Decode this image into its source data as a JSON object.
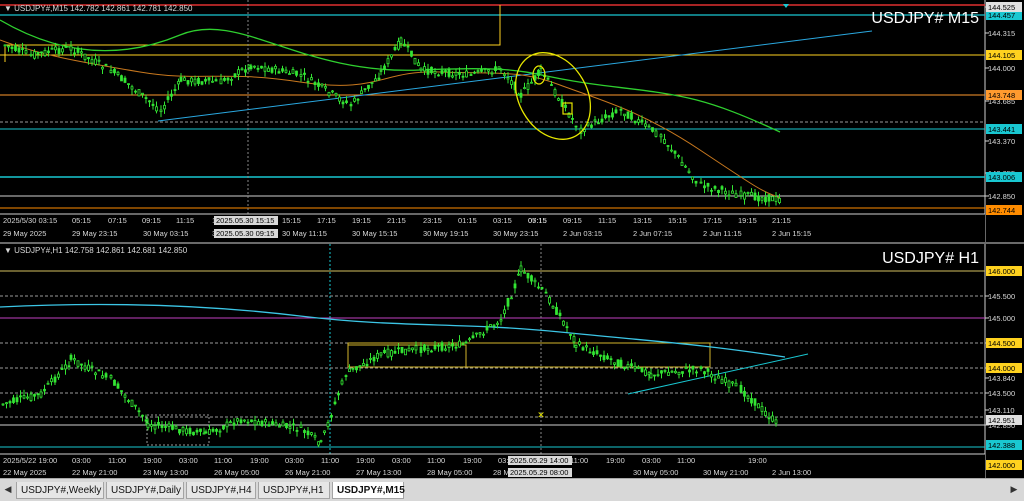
{
  "charts": {
    "m15": {
      "info": "USDJPY#,M15  142.782 142.861 142.781 142.850",
      "title": "USDJPY#  M15",
      "ticks": [
        "144.525",
        "144.315",
        "144.000",
        "143.685",
        "143.370",
        "143.055",
        "142.850"
      ],
      "tags": [
        {
          "text": "144.457",
          "color": "#19c7d1"
        },
        {
          "text": "144.105",
          "color": "#ffd21f"
        },
        {
          "text": "143.748",
          "color": "#ff9a2e"
        },
        {
          "text": "143.441",
          "color": "#19c7d1"
        },
        {
          "text": "143.006",
          "color": "#19c7d1"
        },
        {
          "text": "142.744",
          "color": "#ff8c00"
        },
        {
          "text": "144.525",
          "color": "#e0e0e0"
        }
      ],
      "time_labels": [
        "2025/5/30 03:15",
        "05:15",
        "07:15",
        "09:15",
        "11:15",
        "13:15",
        "15:15",
        "17:15",
        "19:15",
        "21:15",
        "23:15",
        "01:15",
        "03:15",
        "05:15",
        "07:15",
        "09:15",
        "11:15",
        "13:15",
        "15:15",
        "17:15",
        "19:15",
        "21:15"
      ],
      "date_labels": [
        "29 May 2025",
        "29 May 23:15",
        "30 May 03:15",
        "30 May 07:15",
        "30 May 11:15",
        "30 May 15:15",
        "30 May 19:15",
        "30 May 23:15",
        "2 Jun 03:15",
        "2 Jun 07:15",
        "2 Jun 11:15",
        "2 Jun 15:15"
      ],
      "cursor_label_top": "2025.05.30 15:15",
      "cursor_label_bottom": "2025.05.30 09:15"
    },
    "h1": {
      "info": "USDJPY#,H1  142.758 142.861 142.681 142.850",
      "title": "USDJPY#  H1",
      "ticks": [
        "145.500",
        "145.000",
        "144.500",
        "144.000",
        "143.840",
        "143.500",
        "143.110",
        "142.850"
      ],
      "tags": [
        {
          "text": "146.000",
          "color": "#ffd21f"
        },
        {
          "text": "144.500",
          "color": "#ffd21f"
        },
        {
          "text": "144.000",
          "color": "#ffd21f"
        },
        {
          "text": "142.951",
          "color": "#e0e0e0"
        },
        {
          "text": "142.388",
          "color": "#19c7d1"
        },
        {
          "text": "142.000",
          "color": "#ffd21f"
        }
      ],
      "time_labels": [
        "2025/5/22 19:00",
        "03:00",
        "11:00",
        "19:00",
        "03:00",
        "11:00",
        "19:00",
        "03:00",
        "11:00",
        "19:00",
        "03:00",
        "11:00",
        "19:00",
        "03:00",
        "11:00",
        "19:00",
        "03:00",
        "11:00",
        "19:00"
      ],
      "date_labels": [
        "22 May 2025",
        "22 May 21:00",
        "23 May 13:00",
        "26 May 05:00",
        "26 May 21:00",
        "27 May 13:00",
        "28 May 05:00",
        "28 M",
        "30 May 05:00",
        "30 May 21:00",
        "2 Jun 13:00"
      ],
      "cursor_label_top": "2025.05.29 14:00",
      "cursor_label_bottom": "2025.05.29 08:00"
    }
  },
  "tabs": [
    {
      "label": "USDJPY#,Weekly",
      "active": false
    },
    {
      "label": "USDJPY#,Daily",
      "active": false
    },
    {
      "label": "USDJPY#,H4",
      "active": false
    },
    {
      "label": "USDJPY#,H1",
      "active": false
    },
    {
      "label": "USDJPY#,M15",
      "active": true
    }
  ],
  "icons": {
    "nav_left": "triangle-left-icon",
    "nav_right": "triangle-right-icon",
    "menu": "triangle-down-icon"
  }
}
